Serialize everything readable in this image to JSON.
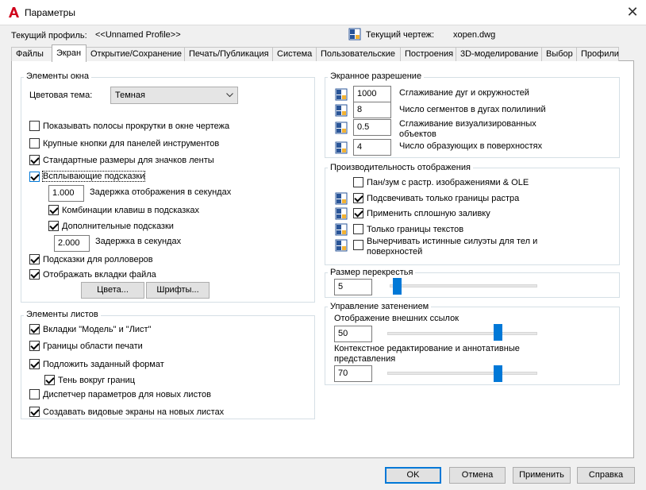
{
  "window": {
    "title": "Параметры",
    "close_glyph": "✕",
    "app_icon": "autocad-a-icon",
    "accent": "#0078d7"
  },
  "header": {
    "profile_label": "Текущий профиль:",
    "profile_value": "<<Unnamed Profile>>",
    "drawing_label": "Текущий чертеж:",
    "drawing_value": "xopen.dwg"
  },
  "tabs": [
    "Файлы",
    "Экран",
    "Открытие/Сохранение",
    "Печать/Публикация",
    "Система",
    "Пользовательские",
    "Построения",
    "3D-моделирование",
    "Выбор",
    "Профили"
  ],
  "active_tab": "Экран",
  "window_elements": {
    "title": "Элементы окна",
    "theme_label": "Цветовая тема:",
    "theme_value": "Темная",
    "show_scrollbars": {
      "label": "Показывать полосы прокрутки в окне чертежа",
      "checked": false
    },
    "large_buttons": {
      "label": "Крупные кнопки для панелей инструментов",
      "checked": false
    },
    "ribbon_icons": {
      "label": "Стандартные размеры для значков ленты",
      "checked": true
    },
    "tooltips": {
      "label": "Всплывающие подсказки",
      "checked": true
    },
    "tooltip_delay_value": "1.000",
    "tooltip_delay_label": "Задержка отображения в секундах",
    "shortcut_keys": {
      "label": "Комбинации клавиш в подсказках",
      "checked": true
    },
    "extended_tooltips": {
      "label": "Дополнительные подсказки",
      "checked": true
    },
    "extended_delay_value": "2.000",
    "extended_delay_label": "Задержка в секундах",
    "rollover": {
      "label": "Подсказки для ролловеров",
      "checked": true
    },
    "file_tabs": {
      "label": "Отображать вкладки файла",
      "checked": true
    },
    "colors_button": "Цвета...",
    "fonts_button": "Шрифты..."
  },
  "layout_elements": {
    "title": "Элементы листов",
    "model_tabs": {
      "label": "Вкладки \"Модель\" и \"Лист\"",
      "checked": true
    },
    "printable_area": {
      "label": "Границы области печати",
      "checked": true
    },
    "paper_background": {
      "label": "Подложить заданный формат",
      "checked": true
    },
    "paper_shadow": {
      "label": "Тень вокруг границ",
      "checked": true
    },
    "page_setup_manager": {
      "label": "Диспетчер параметров для новых листов",
      "checked": false
    },
    "create_viewports": {
      "label": "Создавать видовые экраны на новых листах",
      "checked": true
    }
  },
  "resolution": {
    "title": "Экранное разрешение",
    "rows": [
      {
        "value": "1000",
        "label": "Сглаживание дуг и окружностей"
      },
      {
        "value": "8",
        "label": "Число сегментов в дугах полилиний"
      },
      {
        "value": "0.5",
        "label": "Сглаживание визуализированных объектов"
      },
      {
        "value": "4",
        "label": "Число образующих в поверхностях"
      }
    ]
  },
  "performance": {
    "title": "Производительность отображения",
    "items": [
      {
        "label": "Пан/зум с растр. изображениями & OLE",
        "checked": false
      },
      {
        "label": "Подсвечивать только границы растра",
        "checked": true
      },
      {
        "label": "Применить сплошную заливку",
        "checked": true
      },
      {
        "label": "Только границы текстов",
        "checked": false
      },
      {
        "label": "Вычерчивать истинные силуэты для тел и поверхностей",
        "checked": false
      }
    ]
  },
  "crosshair": {
    "title": "Размер перекрестья",
    "value": "5",
    "slider_fraction": 0.05
  },
  "fade": {
    "title": "Управление затенением",
    "xref_label": "Отображение внешних ссылок",
    "xref_value": "50",
    "xref_fraction": 0.5,
    "inplace_label": "Контекстное редактирование и аннотативные представления",
    "inplace_value": "70",
    "inplace_fraction": 0.5
  },
  "buttons": {
    "ok": "OK",
    "cancel": "Отмена",
    "apply": "Применить",
    "help": "Справка"
  }
}
